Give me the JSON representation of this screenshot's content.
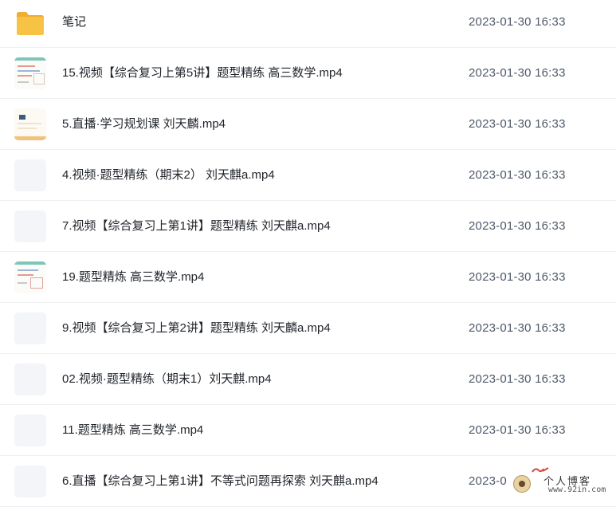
{
  "files": [
    {
      "name": "笔记",
      "date": "2023-01-30 16:33",
      "type": "folder",
      "icon": "folder-icon"
    },
    {
      "name": "15.视频【综合复习上第5讲】题型精练 高三数学.mp4",
      "date": "2023-01-30 16:33",
      "type": "video",
      "icon": "video-thumbnail"
    },
    {
      "name": "5.直播·学习规划课 刘天麟.mp4",
      "date": "2023-01-30 16:33",
      "type": "video",
      "icon": "video-thumbnail"
    },
    {
      "name": "4.视频·题型精练（期末2） 刘天麒a.mp4",
      "date": "2023-01-30 16:33",
      "type": "video",
      "icon": "video-placeholder-icon"
    },
    {
      "name": "7.视频【综合复习上第1讲】题型精练 刘天麒a.mp4",
      "date": "2023-01-30 16:33",
      "type": "video",
      "icon": "video-placeholder-icon"
    },
    {
      "name": "19.题型精炼 高三数学.mp4",
      "date": "2023-01-30 16:33",
      "type": "video",
      "icon": "video-thumbnail"
    },
    {
      "name": "9.视频【综合复习上第2讲】题型精练 刘天麟a.mp4",
      "date": "2023-01-30 16:33",
      "type": "video",
      "icon": "video-placeholder-icon"
    },
    {
      "name": "02.视频·题型精练（期末1）刘天麒.mp4",
      "date": "2023-01-30 16:33",
      "type": "video",
      "icon": "video-placeholder-icon"
    },
    {
      "name": "11.题型精炼 高三数学.mp4",
      "date": "2023-01-30 16:33",
      "type": "video",
      "icon": "video-placeholder-icon"
    },
    {
      "name": "6.直播【综合复习上第1讲】不等式问题再探索 刘天麒a.mp4",
      "date": "2023-0",
      "type": "video",
      "icon": "video-placeholder-icon"
    }
  ],
  "watermark": {
    "title": "个人博客",
    "url": "www.92in.com"
  },
  "colors": {
    "folder": "#f7c344",
    "row_divider": "#eef0f4",
    "date_text": "#4e5969",
    "name_text": "#1f2329"
  }
}
